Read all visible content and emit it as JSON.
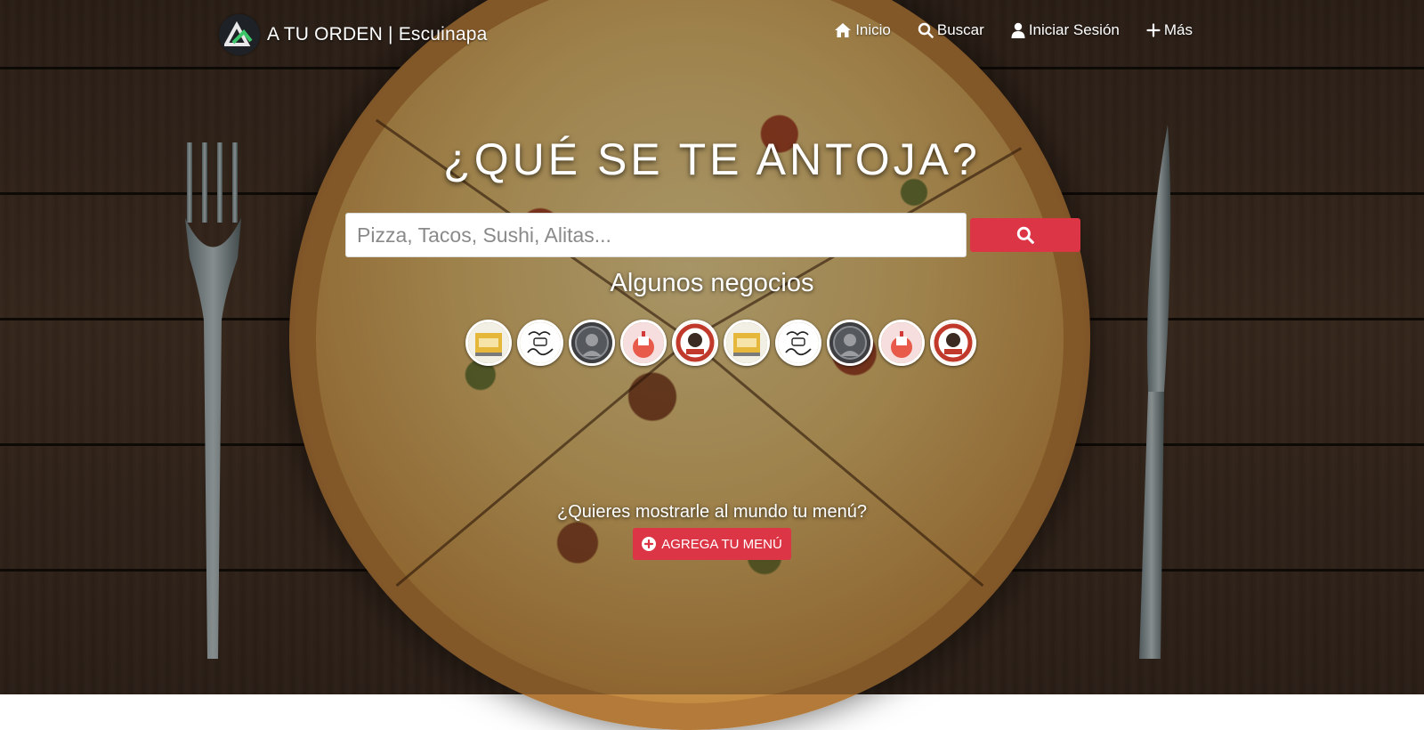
{
  "header": {
    "brand_name": "A TU ORDEN | Escuinapa",
    "nav": [
      {
        "label": "Inicio",
        "icon": "home-icon"
      },
      {
        "label": "Buscar",
        "icon": "search-icon"
      },
      {
        "label": "Iniciar Sesión",
        "icon": "user-icon"
      },
      {
        "label": "Más",
        "icon": "plus-icon"
      }
    ]
  },
  "hero": {
    "title": "¿QUÉ SE TE ANTOJA?",
    "search_placeholder": "Pizza, Tacos, Sushi, Alitas..."
  },
  "businesses": {
    "heading": "Algunos negocios",
    "logos": [
      {
        "icon": "restaurant-logo-yellow"
      },
      {
        "icon": "crepe-coffee-logo"
      },
      {
        "icon": "portrait-logo-dark"
      },
      {
        "icon": "cake-logo-pink"
      },
      {
        "icon": "don-nacho-logo"
      },
      {
        "icon": "restaurant-logo-yellow"
      },
      {
        "icon": "crepe-coffee-logo"
      },
      {
        "icon": "portrait-logo-dark"
      },
      {
        "icon": "cake-logo-pink"
      },
      {
        "icon": "don-nacho-logo"
      }
    ]
  },
  "promo": {
    "question": "¿Quieres mostrarle al mundo tu menú?",
    "button_label": "AGREGA TU MENÚ"
  },
  "colors": {
    "accent": "#dc3545",
    "text": "#ffffff"
  }
}
